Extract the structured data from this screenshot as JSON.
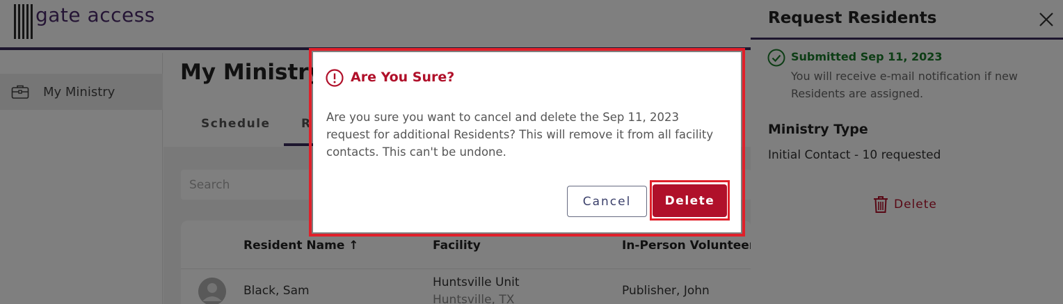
{
  "app": {
    "logo_text": "gate access"
  },
  "sidebar": {
    "items": [
      {
        "label": "My Ministry",
        "icon": "briefcase-icon"
      }
    ]
  },
  "main": {
    "title": "My Ministry",
    "tabs": [
      {
        "label": "Schedule"
      },
      {
        "label": "R"
      }
    ],
    "search_placeholder": "Search",
    "table": {
      "columns": [
        "Resident Name ↑",
        "Facility",
        "In-Person Volunteer"
      ],
      "rows": [
        {
          "name": "Black, Sam",
          "facility": "Huntsville Unit",
          "facility_location": "Huntsville, TX",
          "volunteer": "Publisher, John"
        }
      ]
    }
  },
  "drawer": {
    "title": "Request Residents",
    "status_title": "Submitted Sep 11, 2023",
    "status_description": "You will receive e-mail notification if new Residents are assigned.",
    "ministry_type_heading": "Ministry Type",
    "ministry_type_value": "Initial Contact - 10 requested",
    "delete_label": "Delete"
  },
  "dialog": {
    "title": "Are You Sure?",
    "message": "Are you sure you want to cancel and delete the Sep 11, 2023 request for additional Residents? This will remove it from all facility contacts. This can't be undone.",
    "cancel_label": "Cancel",
    "delete_label": "Delete"
  },
  "colors": {
    "brand_purple": "#3a2d5c",
    "danger": "#b0102a",
    "highlight_outline": "#e0202a",
    "success": "#1a7a2a"
  }
}
